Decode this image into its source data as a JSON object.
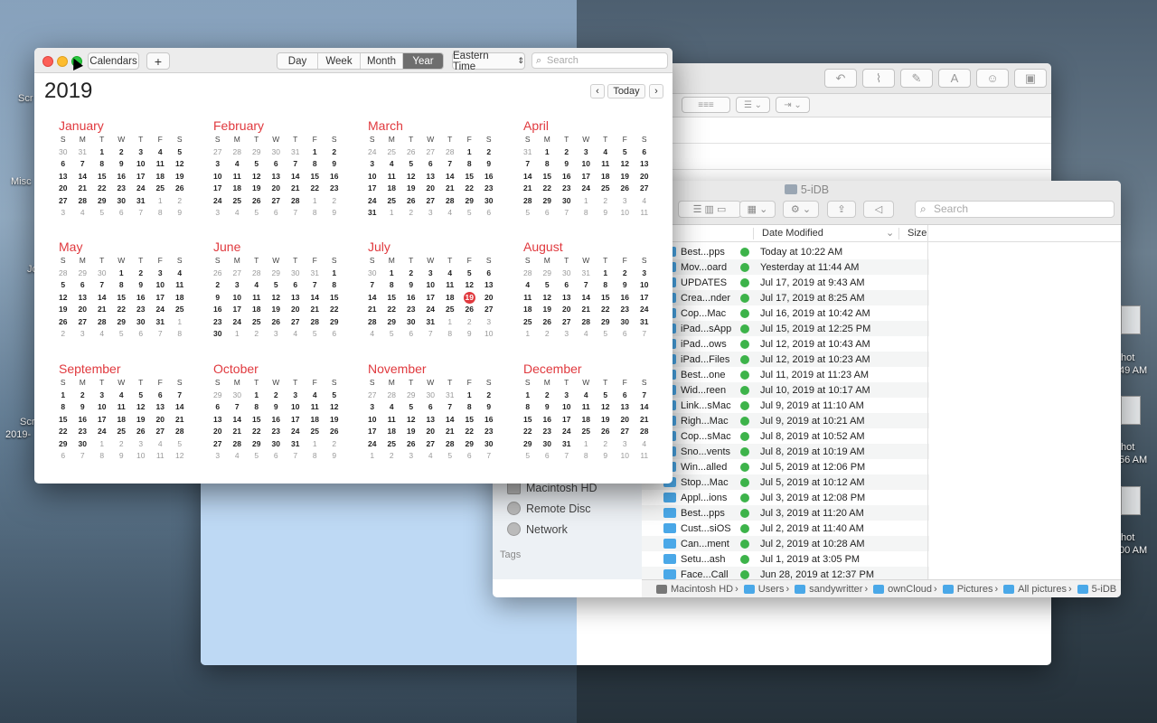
{
  "desktop": {
    "left_labels": [
      "Scr",
      "Misc",
      "Jo",
      "Scr",
      "2019-"
    ],
    "right_labels": [
      [
        "hot",
        "49 AM"
      ],
      [
        "hot",
        "56 AM"
      ],
      [
        "hot",
        "00 AM"
      ]
    ]
  },
  "mail": {
    "toolbar_icons": [
      "reply-icon",
      "paperclip-icon",
      "markup-icon",
      "font-icon",
      "emoji-icon",
      "photo-icon"
    ],
    "format_labels": {
      "font_A": "A"
    }
  },
  "finder": {
    "title": "5-iDB",
    "search_placeholder": "Search",
    "sidebar": [
      "Macintosh HD",
      "Remote Disc",
      "Network"
    ],
    "tags_label": "Tags",
    "columns": {
      "date": "Date Modified",
      "size": "Size"
    },
    "files": [
      {
        "name": "Best...pps",
        "date": "Today at 10:22 AM"
      },
      {
        "name": "Mov...oard",
        "date": "Yesterday at 11:44 AM"
      },
      {
        "name": "UPDATES",
        "date": "Jul 17, 2019 at 9:43 AM"
      },
      {
        "name": "Crea...nder",
        "date": "Jul 17, 2019 at 8:25 AM"
      },
      {
        "name": "Cop...Mac",
        "date": "Jul 16, 2019 at 10:42 AM"
      },
      {
        "name": "iPad...sApp",
        "date": "Jul 15, 2019 at 12:25 PM"
      },
      {
        "name": "iPad...ows",
        "date": "Jul 12, 2019 at 10:43 AM"
      },
      {
        "name": "iPad...Files",
        "date": "Jul 12, 2019 at 10:23 AM"
      },
      {
        "name": "Best...one",
        "date": "Jul 11, 2019 at 11:23 AM"
      },
      {
        "name": "Wid...reen",
        "date": "Jul 10, 2019 at 10:17 AM"
      },
      {
        "name": "Link...sMac",
        "date": "Jul 9, 2019 at 11:10 AM"
      },
      {
        "name": "Righ...Mac",
        "date": "Jul 9, 2019 at 10:21 AM"
      },
      {
        "name": "Cop...sMac",
        "date": "Jul 8, 2019 at 10:52 AM"
      },
      {
        "name": "Sno...vents",
        "date": "Jul 8, 2019 at 10:19 AM"
      },
      {
        "name": "Win...alled",
        "date": "Jul 5, 2019 at 12:06 PM"
      },
      {
        "name": "Stop...Mac",
        "date": "Jul 5, 2019 at 10:12 AM"
      },
      {
        "name": "Appl...ions",
        "date": "Jul 3, 2019 at 12:08 PM"
      },
      {
        "name": "Best...pps",
        "date": "Jul 3, 2019 at 11:20 AM"
      },
      {
        "name": "Cust...siOS",
        "date": "Jul 2, 2019 at 11:40 AM"
      },
      {
        "name": "Can...ment",
        "date": "Jul 2, 2019 at 10:28 AM"
      },
      {
        "name": "Setu...ash",
        "date": "Jul 1, 2019 at 3:05 PM"
      },
      {
        "name": "Face...Call",
        "date": "Jun 28, 2019 at 12:37 PM"
      }
    ],
    "path": [
      "Macintosh HD",
      "Users",
      "sandywritter",
      "ownCloud",
      "Pictures",
      "All pictures",
      "5-iDB"
    ]
  },
  "calendar": {
    "calendars_label": "Calendars",
    "add_label": "+",
    "views": [
      "Day",
      "Week",
      "Month",
      "Year"
    ],
    "active_view": "Year",
    "timezone": "Eastern Time",
    "search_placeholder": "Search",
    "year": "2019",
    "today_label": "Today",
    "prev_label": "‹",
    "next_label": "›",
    "weekdays": [
      "S",
      "M",
      "T",
      "W",
      "T",
      "F",
      "S"
    ],
    "today": {
      "month": 6,
      "day": 19
    },
    "months": [
      {
        "name": "January",
        "start": 2,
        "days": 31,
        "prev_days": 31
      },
      {
        "name": "February",
        "start": 5,
        "days": 28,
        "prev_days": 31
      },
      {
        "name": "March",
        "start": 5,
        "days": 31,
        "prev_days": 28
      },
      {
        "name": "April",
        "start": 1,
        "days": 30,
        "prev_days": 31
      },
      {
        "name": "May",
        "start": 3,
        "days": 31,
        "prev_days": 30
      },
      {
        "name": "June",
        "start": 6,
        "days": 30,
        "prev_days": 31
      },
      {
        "name": "July",
        "start": 1,
        "days": 31,
        "prev_days": 30
      },
      {
        "name": "August",
        "start": 4,
        "days": 31,
        "prev_days": 31
      },
      {
        "name": "September",
        "start": 0,
        "days": 30,
        "prev_days": 31
      },
      {
        "name": "October",
        "start": 2,
        "days": 31,
        "prev_days": 30
      },
      {
        "name": "November",
        "start": 5,
        "days": 30,
        "prev_days": 31
      },
      {
        "name": "December",
        "start": 0,
        "days": 31,
        "prev_days": 30
      }
    ]
  }
}
